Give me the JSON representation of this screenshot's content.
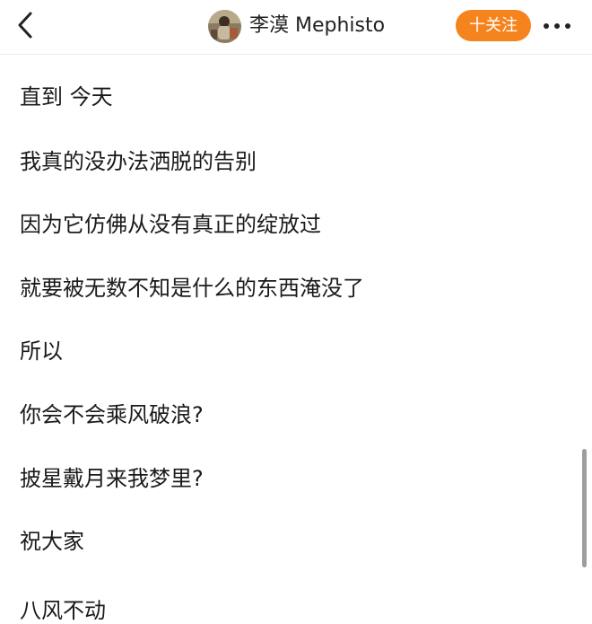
{
  "header": {
    "back_icon": "chevron-left-icon",
    "username": "李漠 Mephisto",
    "follow_label": "十关注",
    "more_icon": "more-horizontal-icon",
    "accent_color": "#f5841f"
  },
  "post": {
    "lines": [
      "直到 今天",
      "我真的没办法洒脱的告别",
      "因为它仿佛从没有真正的绽放过",
      "就要被无数不知是什么的东西淹没了",
      "所以",
      "你会不会乘风破浪?",
      "披星戴月来我梦里?",
      "祝大家",
      "八风不动"
    ]
  }
}
